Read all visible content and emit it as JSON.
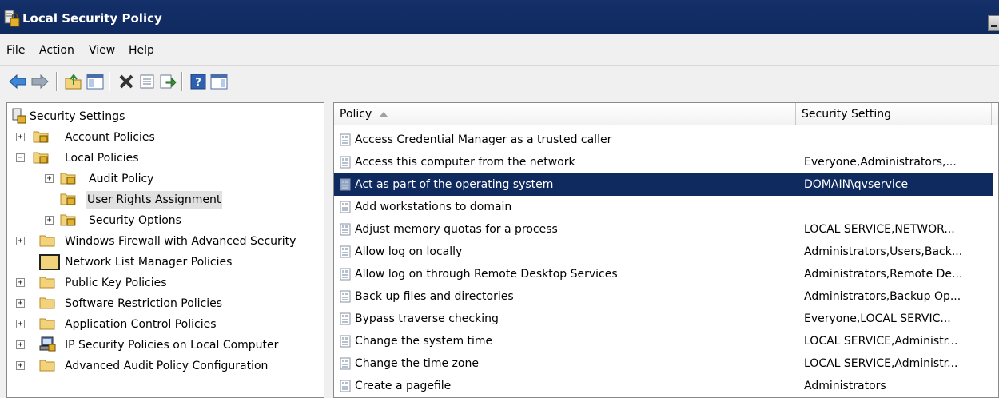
{
  "window": {
    "title": "Local Security Policy"
  },
  "menu": [
    "File",
    "Action",
    "View",
    "Help"
  ],
  "toolbar": {
    "buttons": [
      "back-icon",
      "forward-icon",
      "up-folder-icon",
      "show-hide-tree-icon",
      "delete-icon",
      "properties-icon",
      "export-list-icon",
      "help-icon",
      "show-hide-action-pane-icon"
    ]
  },
  "tree": {
    "root": "Security Settings",
    "items": [
      {
        "label": "Account Policies",
        "expander": "+"
      },
      {
        "label": "Local Policies",
        "expander": "−"
      },
      {
        "label": "Audit Policy",
        "expander": "+"
      },
      {
        "label": "User Rights Assignment",
        "expander": ""
      },
      {
        "label": "Security Options",
        "expander": "+"
      },
      {
        "label": "Windows Firewall with Advanced Security",
        "expander": "+"
      },
      {
        "label": "Network List Manager Policies",
        "expander": ""
      },
      {
        "label": "Public Key Policies",
        "expander": "+"
      },
      {
        "label": "Software Restriction Policies",
        "expander": "+"
      },
      {
        "label": "Application Control Policies",
        "expander": "+"
      },
      {
        "label": "IP Security Policies on Local Computer",
        "expander": "+"
      },
      {
        "label": "Advanced Audit Policy Configuration",
        "expander": "+"
      }
    ]
  },
  "list": {
    "columns": {
      "policy": "Policy",
      "setting": "Security Setting"
    },
    "rows": [
      {
        "policy": "Access Credential Manager as a trusted caller",
        "setting": ""
      },
      {
        "policy": "Access this computer from the network",
        "setting": "Everyone,Administrators,..."
      },
      {
        "policy": "Act as part of the operating system",
        "setting": "DOMAIN\\qvservice"
      },
      {
        "policy": "Add workstations to domain",
        "setting": ""
      },
      {
        "policy": "Adjust memory quotas for a process",
        "setting": "LOCAL SERVICE,NETWOR..."
      },
      {
        "policy": "Allow log on locally",
        "setting": "Administrators,Users,Back..."
      },
      {
        "policy": "Allow log on through Remote Desktop Services",
        "setting": "Administrators,Remote De..."
      },
      {
        "policy": "Back up files and directories",
        "setting": "Administrators,Backup Op..."
      },
      {
        "policy": "Bypass traverse checking",
        "setting": "Everyone,LOCAL SERVIC..."
      },
      {
        "policy": "Change the system time",
        "setting": "LOCAL SERVICE,Administr..."
      },
      {
        "policy": "Change the time zone",
        "setting": "LOCAL SERVICE,Administr..."
      },
      {
        "policy": "Create a pagefile",
        "setting": "Administrators"
      }
    ]
  },
  "colors": {
    "titlebar": "#0e2a5f",
    "selection": "#0f2a5e",
    "folder": "#f2d27a"
  }
}
